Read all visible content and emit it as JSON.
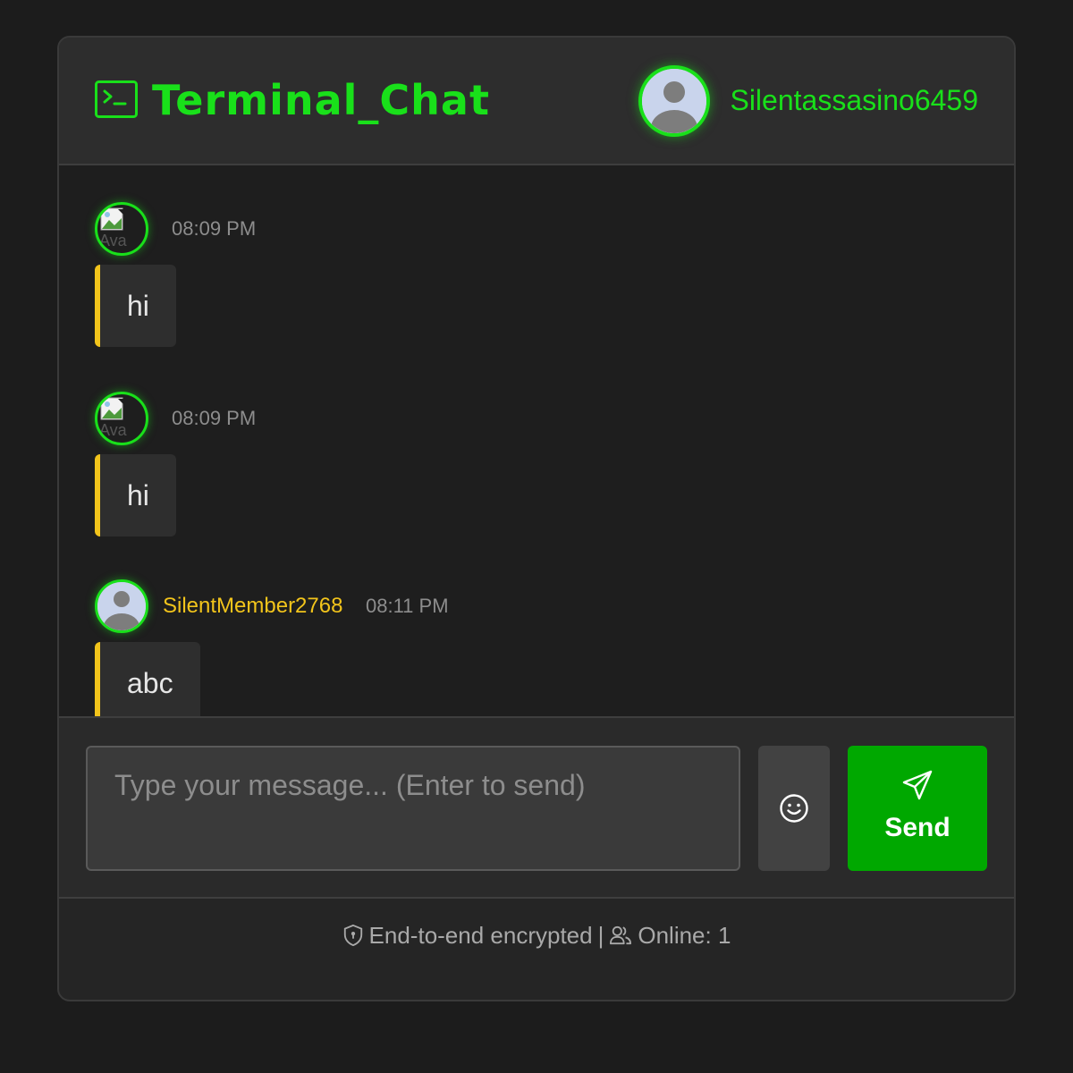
{
  "header": {
    "title": "Terminal_Chat",
    "icon": "terminal-icon",
    "username": "Silentassasino6459",
    "accent_color": "#19e01a"
  },
  "messages": [
    {
      "author": "",
      "avatar": "broken-image",
      "avatar_alt": "Ava",
      "time": "08:09 PM",
      "text": "hi"
    },
    {
      "author": "",
      "avatar": "broken-image",
      "avatar_alt": "Ava",
      "time": "08:09 PM",
      "text": "hi"
    },
    {
      "author": "SilentMember2768",
      "avatar": "default-user",
      "time": "08:11 PM",
      "text": "abc"
    }
  ],
  "composer": {
    "placeholder": "Type your message... (Enter to send)",
    "value": "",
    "emoji_icon": "smiley-icon",
    "send_label": "Send",
    "send_icon": "paper-plane-icon",
    "send_color": "#00a800"
  },
  "footer": {
    "encryption_text": "End-to-end encrypted",
    "separator": "|",
    "online_text": "Online: 1"
  }
}
